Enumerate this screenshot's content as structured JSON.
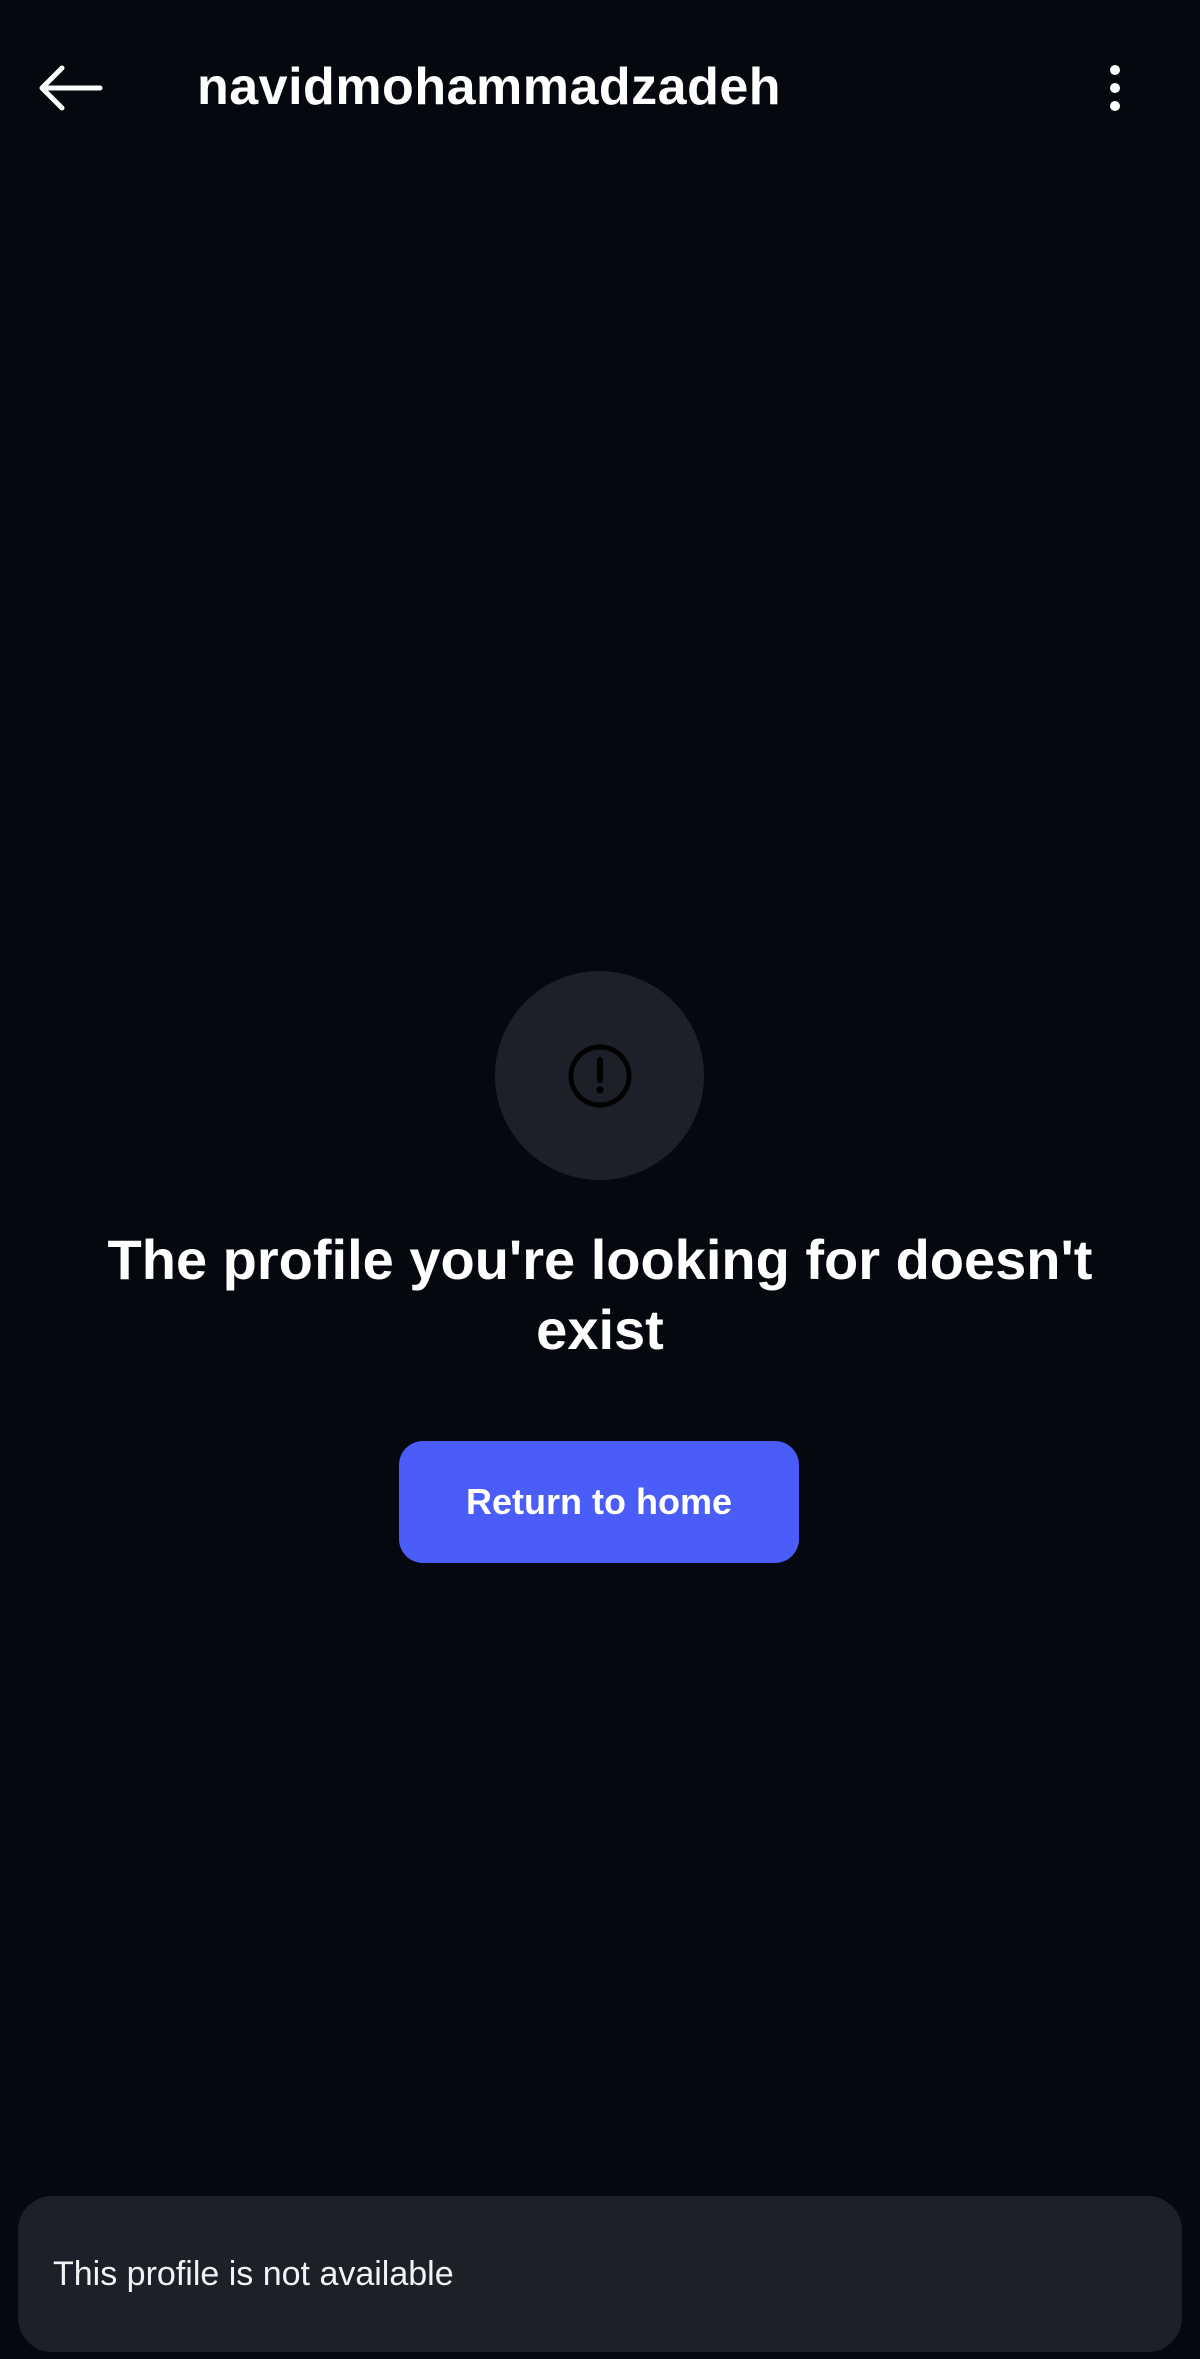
{
  "header": {
    "title": "navidmohammadzadeh",
    "back_icon": "arrow-left-icon",
    "menu_icon": "more-vertical-icon"
  },
  "error": {
    "icon": "alert-circle-icon",
    "message": "The profile you're looking for doesn't exist",
    "return_button_label": "Return to home"
  },
  "toast": {
    "text": "This profile is not available"
  },
  "colors": {
    "background": "#05080f",
    "surface": "#1d2029",
    "accent": "#4a5df9",
    "text": "#ffffff"
  }
}
